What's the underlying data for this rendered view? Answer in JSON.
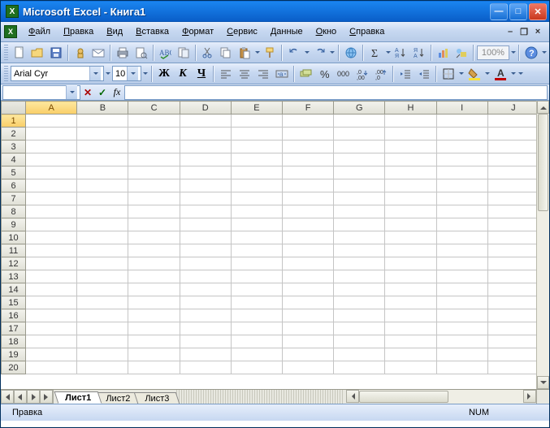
{
  "title": "Microsoft Excel - Книга1",
  "menu": [
    "Файл",
    "Правка",
    "Вид",
    "Вставка",
    "Формат",
    "Сервис",
    "Данные",
    "Окно",
    "Справка"
  ],
  "toolbar": {
    "zoom": "100%"
  },
  "format": {
    "font": "Arial Cyr",
    "size": "10",
    "bold": "Ж",
    "italic": "К",
    "underline": "Ч",
    "color_letter": "A"
  },
  "formula": {
    "name_box": "",
    "fx": "fx",
    "value": ""
  },
  "columns": [
    "A",
    "B",
    "C",
    "D",
    "E",
    "F",
    "G",
    "H",
    "I",
    "J"
  ],
  "rows": [
    "1",
    "2",
    "3",
    "4",
    "5",
    "6",
    "7",
    "8",
    "9",
    "10",
    "11",
    "12",
    "13",
    "14",
    "15",
    "16",
    "17",
    "18",
    "19",
    "20"
  ],
  "active": {
    "col": 0,
    "row": 0
  },
  "sheets": {
    "active": 0,
    "tabs": [
      "Лист1",
      "Лист2",
      "Лист3"
    ]
  },
  "status": {
    "mode": "Правка",
    "num": "NUM"
  }
}
